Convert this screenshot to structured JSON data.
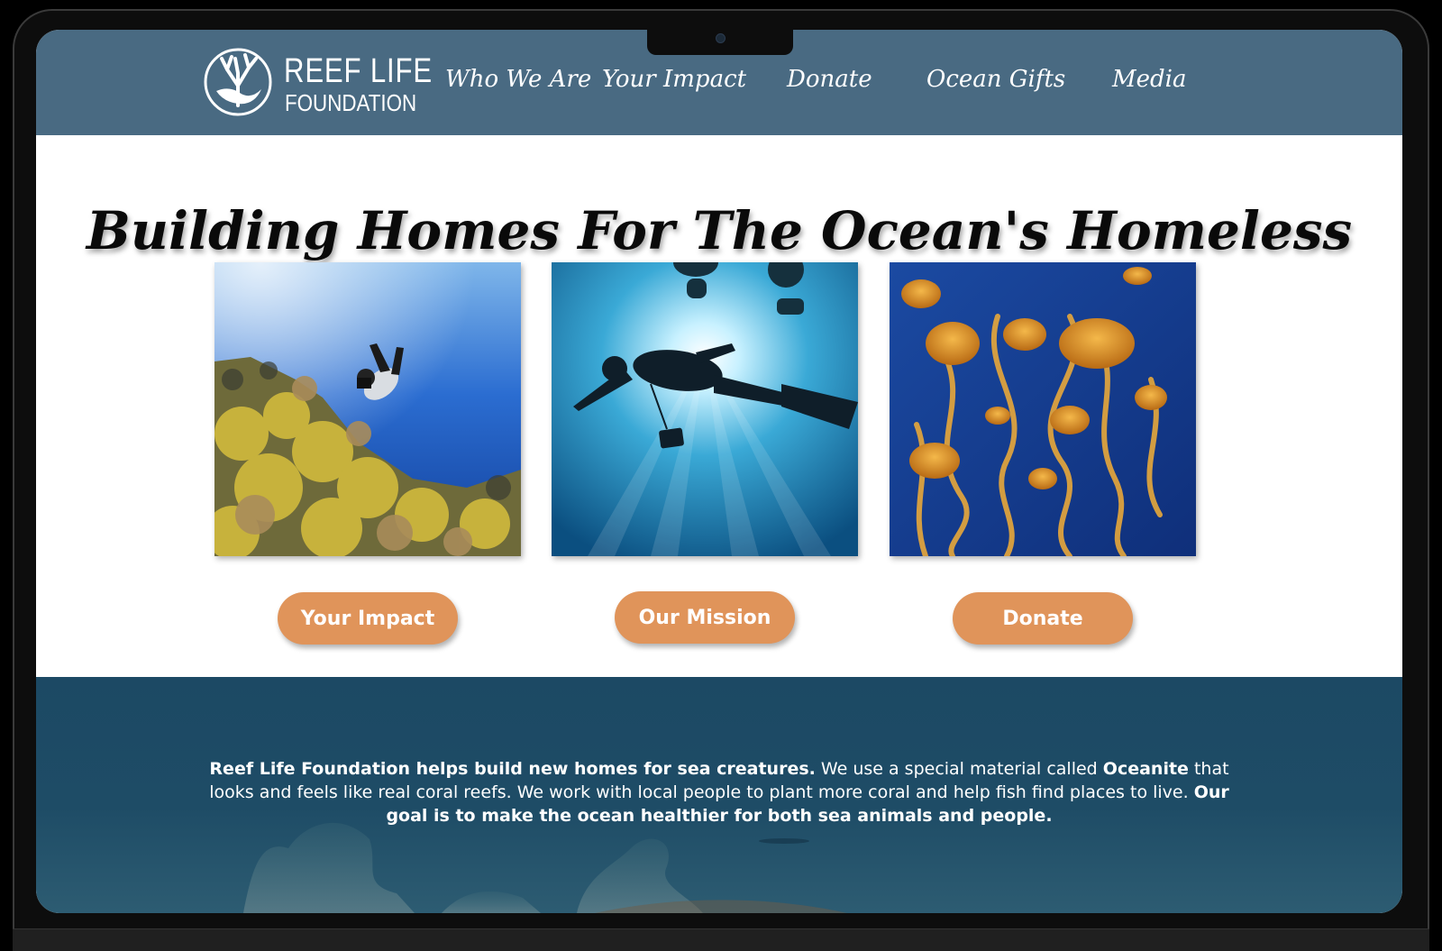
{
  "brand": {
    "name_line1": "REEF LIFE",
    "name_line2": "FOUNDATION"
  },
  "nav": {
    "items": [
      {
        "label": "Who We Are"
      },
      {
        "label": "Your Impact"
      },
      {
        "label": "Donate"
      },
      {
        "label": "Ocean Gifts"
      },
      {
        "label": "Media"
      }
    ]
  },
  "hero": {
    "title": "Building Homes For The Ocean's Homeless"
  },
  "cards": [
    {
      "image": "scuba-diver-over-coral-reef",
      "button": "Your Impact"
    },
    {
      "image": "diver-silhouette-sunlight",
      "button": "Our Mission"
    },
    {
      "image": "orange-jellyfish",
      "button": "Donate"
    }
  ],
  "mission": {
    "part1_bold": "Reef Life Foundation helps build new homes for sea creatures.",
    "part2": " We use a special material called ",
    "part3_bold": "Oceanite",
    "part4": " that looks and feels like real coral reefs. We work with local people to plant more coral and help fish find places to live. ",
    "part5_bold": "Our goal is to make the ocean healthier for both sea animals and people."
  },
  "colors": {
    "header_bg": "#496a82",
    "button_bg": "#e0945a",
    "band_bg": "#1c4964"
  }
}
